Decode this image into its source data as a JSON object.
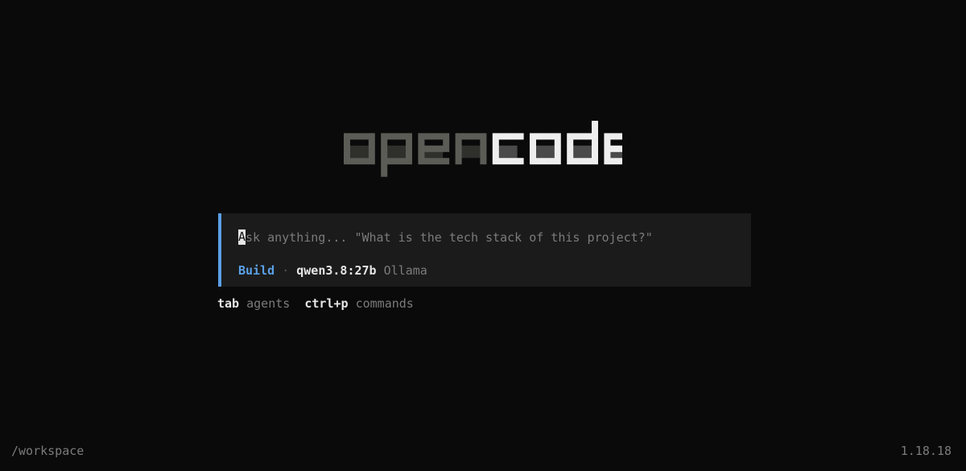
{
  "logo": {
    "part1": "open",
    "part2": "code",
    "part1_color": "#5c5c57",
    "part2_color": "#eeeeee"
  },
  "prompt": {
    "cursor_char": "A",
    "placeholder_rest": "sk anything... \"What is the tech stack of this project?\"",
    "mode": "Build",
    "separator": "·",
    "model": "qwen3.8:27b",
    "provider": "Ollama",
    "accent_color": "#5aa0e6"
  },
  "hints": {
    "tab_key": "tab",
    "tab_desc": "agents",
    "cmd_key": "ctrl+p",
    "cmd_desc": "commands"
  },
  "footer": {
    "path": "/workspace",
    "version": "1.18.18"
  }
}
